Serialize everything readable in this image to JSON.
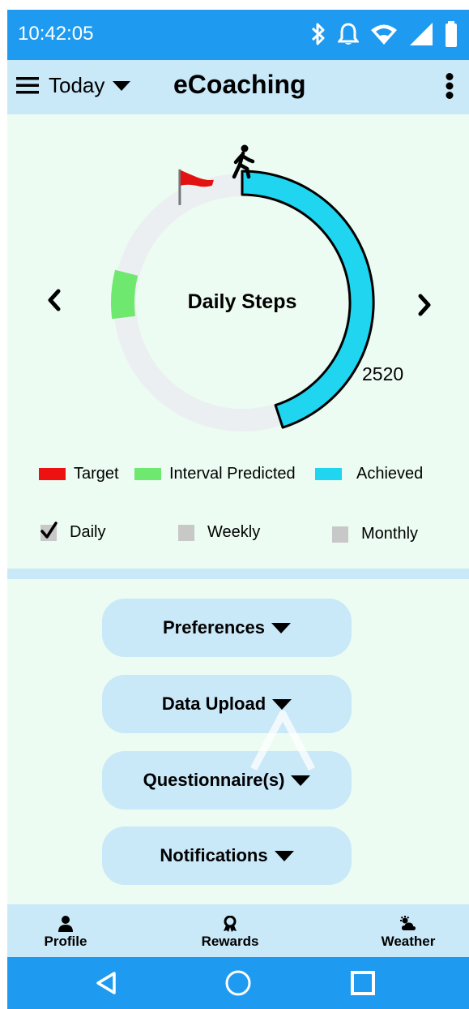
{
  "status_bar": {
    "time": "10:42:05",
    "icons": [
      "bluetooth-icon",
      "bell-icon",
      "wifi-icon",
      "signal-icon",
      "battery-icon"
    ]
  },
  "app_bar": {
    "menu_icon": "hamburger-menu-icon",
    "period_selector": "Today",
    "title": "eCoaching",
    "overflow_icon": "more-vertical-icon"
  },
  "ring_chart": {
    "label": "Daily Steps",
    "achieved_value": "2520",
    "achieved_fraction": 0.45,
    "interval_predicted_range": [
      0.73,
      0.79
    ],
    "target_marker_fraction": 0.92,
    "walker_icon": "walking-person-icon",
    "target_icon": "red-flag-icon",
    "prev_icon": "chevron-left-icon",
    "next_icon": "chevron-right-icon"
  },
  "legend": [
    {
      "label": "Target",
      "color": "#ee1111"
    },
    {
      "label": "Interval Predicted",
      "color": "#6ee86e"
    },
    {
      "label": "Achieved",
      "color": "#1fd5ef"
    }
  ],
  "period_options": [
    {
      "label": "Daily",
      "checked": true
    },
    {
      "label": "Weekly",
      "checked": false
    },
    {
      "label": "Monthly",
      "checked": false
    }
  ],
  "sections": [
    {
      "label": "Preferences"
    },
    {
      "label": "Data Upload"
    },
    {
      "label": "Questionnaire(s)"
    },
    {
      "label": "Notifications"
    }
  ],
  "bottom_nav": [
    {
      "label": "Profile",
      "icon": "person-icon"
    },
    {
      "label": "Rewards",
      "icon": "award-icon"
    },
    {
      "label": "Weather",
      "icon": "weather-icon"
    }
  ],
  "system_nav": [
    "back-icon",
    "home-icon",
    "recents-icon"
  ],
  "colors": {
    "status_bar": "#1e9bf0",
    "app_bar": "#c9e8f8",
    "panel_background": "#ecfcf2",
    "ring_track": "#eceff2",
    "achieved": "#1fd5ef",
    "interval_predicted": "#6ee86e",
    "target": "#ee1111"
  }
}
